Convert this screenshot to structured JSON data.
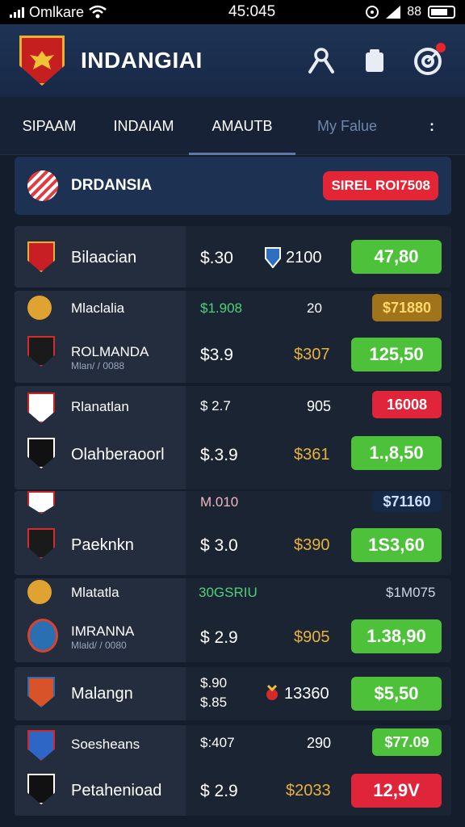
{
  "status": {
    "carrier": "Omlkare",
    "time": "45:045",
    "network": "88"
  },
  "header": {
    "title": "INDANGIAI"
  },
  "tabs": [
    {
      "label": "SIPAAM"
    },
    {
      "label": "INDAIAM"
    },
    {
      "label": "AMAUTB"
    },
    {
      "label": "My Falue"
    },
    {
      "label": ":"
    }
  ],
  "banner": {
    "title": "DRDANSIA",
    "badge": "SIREL ROI7508"
  },
  "matches": [
    {
      "team": "Bilaacian",
      "price": "$.30",
      "mid": "2100",
      "odd": "47,80",
      "odd_color": "#4ec13a"
    },
    {
      "team": "Mlaclalia",
      "price": "$1.908",
      "mid": "20",
      "odd": "$71880",
      "odd_color": "#a1731a"
    },
    {
      "team": "ROLMANDA",
      "sub": "Mlan/ / 0088",
      "price": "$3.9",
      "mid": "$307",
      "odd": "125,50",
      "odd_color": "#4ec13a"
    },
    {
      "team": "Rlanatlan",
      "price": "$ 2.7",
      "mid": "905",
      "odd": "16008",
      "odd_color": "#e0253a"
    },
    {
      "team": "Olahberaoorl",
      "price": "$.3.9",
      "mid": "$361",
      "odd": "1.,8,50",
      "odd_color": "#4ec13a"
    },
    {
      "team": "",
      "price": "M.010",
      "mid": "",
      "odd": "$71160",
      "odd_color": "#162a48"
    },
    {
      "team": "Paeknkn",
      "price": "$ 3.0",
      "mid": "$390",
      "odd": "1S3,60",
      "odd_color": "#4ec13a"
    },
    {
      "team": "Mlatatla",
      "price": "30GSRIU",
      "mid": "$1M075",
      "odd": "",
      "odd_color": ""
    },
    {
      "team": "IMRANNA",
      "sub": "Mlald/ / 0080",
      "price": "$ 2.9",
      "mid": "$905",
      "odd": "1.38,90",
      "odd_color": "#4ec13a"
    },
    {
      "team": "Malangn",
      "price": "$.90",
      "price2": "$.85",
      "mid": "13360",
      "odd": "$5,50",
      "odd_color": "#4ec13a"
    },
    {
      "team": "Soesheans",
      "price": "$:407",
      "mid": "290",
      "odd": "$77.09",
      "odd_color": "#4ec13a"
    },
    {
      "team": "Petahenioad",
      "price": "$ 2.9",
      "mid": "$2033",
      "odd": "12,9V",
      "odd_color": "#e0253a"
    }
  ]
}
